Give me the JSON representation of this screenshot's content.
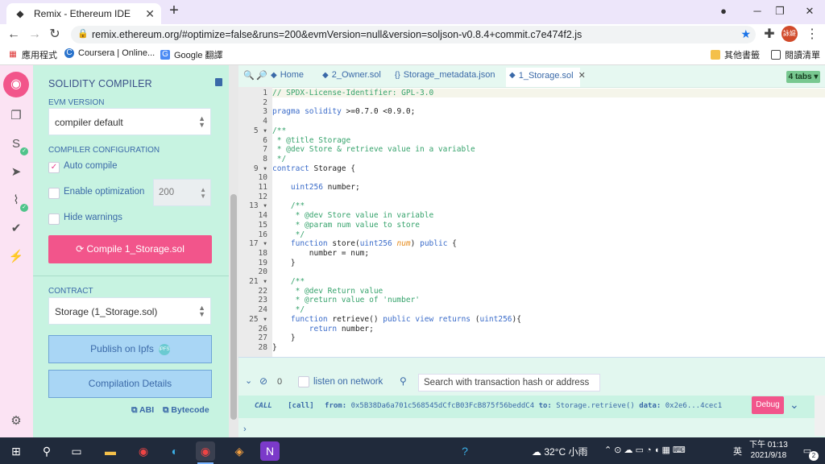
{
  "browser": {
    "tab_title": "Remix - Ethereum IDE",
    "url": "remix.ethereum.org/#optimize=false&runs=200&evmVersion=null&version=soljson-v0.8.4+commit.c7e474f2.js",
    "avatar_text": "詠媞",
    "bookmarks": [
      "應用程式",
      "Coursera | Online...",
      "Google 翻譯"
    ],
    "bookmarks_right": [
      "其他書籤",
      "閱讀清單"
    ]
  },
  "compiler": {
    "title": "SOLIDITY COMPILER",
    "evm_label": "EVM VERSION",
    "evm_value": "compiler default",
    "config_label": "COMPILER CONFIGURATION",
    "auto_compile": "Auto compile",
    "enable_optimization": "Enable optimization",
    "runs": "200",
    "hide_warnings": "Hide warnings",
    "compile_button": "Compile 1_Storage.sol",
    "contract_label": "CONTRACT",
    "contract_value": "Storage (1_Storage.sol)",
    "publish_button": "Publish on Ipfs",
    "details_button": "Compilation Details",
    "abi": "ABI",
    "bytecode": "Bytecode"
  },
  "editor": {
    "tabs": [
      "Home",
      "2_Owner.sol",
      "Storage_metadata.json",
      "1_Storage.sol"
    ],
    "tabs_count": "4 tabs",
    "lines": [
      "// SPDX-License-Identifier: GPL-3.0",
      "",
      "pragma solidity >=0.7.0 <0.9.0;",
      "",
      "/**",
      " * @title Storage",
      " * @dev Store & retrieve value in a variable",
      " */",
      "contract Storage {",
      "",
      "    uint256 number;",
      "",
      "    /**",
      "     * @dev Store value in variable",
      "     * @param num value to store",
      "     */",
      "    function store(uint256 num) public {",
      "        number = num;",
      "    }",
      "",
      "    /**",
      "     * @dev Return value",
      "     * @return value of 'number'",
      "     */",
      "    function retrieve() public view returns (uint256){",
      "        return number;",
      "    }",
      "}"
    ]
  },
  "terminal": {
    "count": "0",
    "listen_label": "listen on network",
    "search_placeholder": "Search with transaction hash or address",
    "log_type": "CALL",
    "log_call": "[call]",
    "log_from_label": "from:",
    "log_from": "0x5B38Da6a701c568545dCfcB03FcB875f56beddC4",
    "log_to_label": "to:",
    "log_to": "Storage.retrieve()",
    "log_data_label": "data:",
    "log_data": "0x2e6...4cec1",
    "debug_button": "Debug"
  },
  "taskbar": {
    "weather": "32°C 小雨",
    "ime": "英",
    "time": "下午 01:13",
    "date": "2021/9/18",
    "notifications": "2"
  }
}
